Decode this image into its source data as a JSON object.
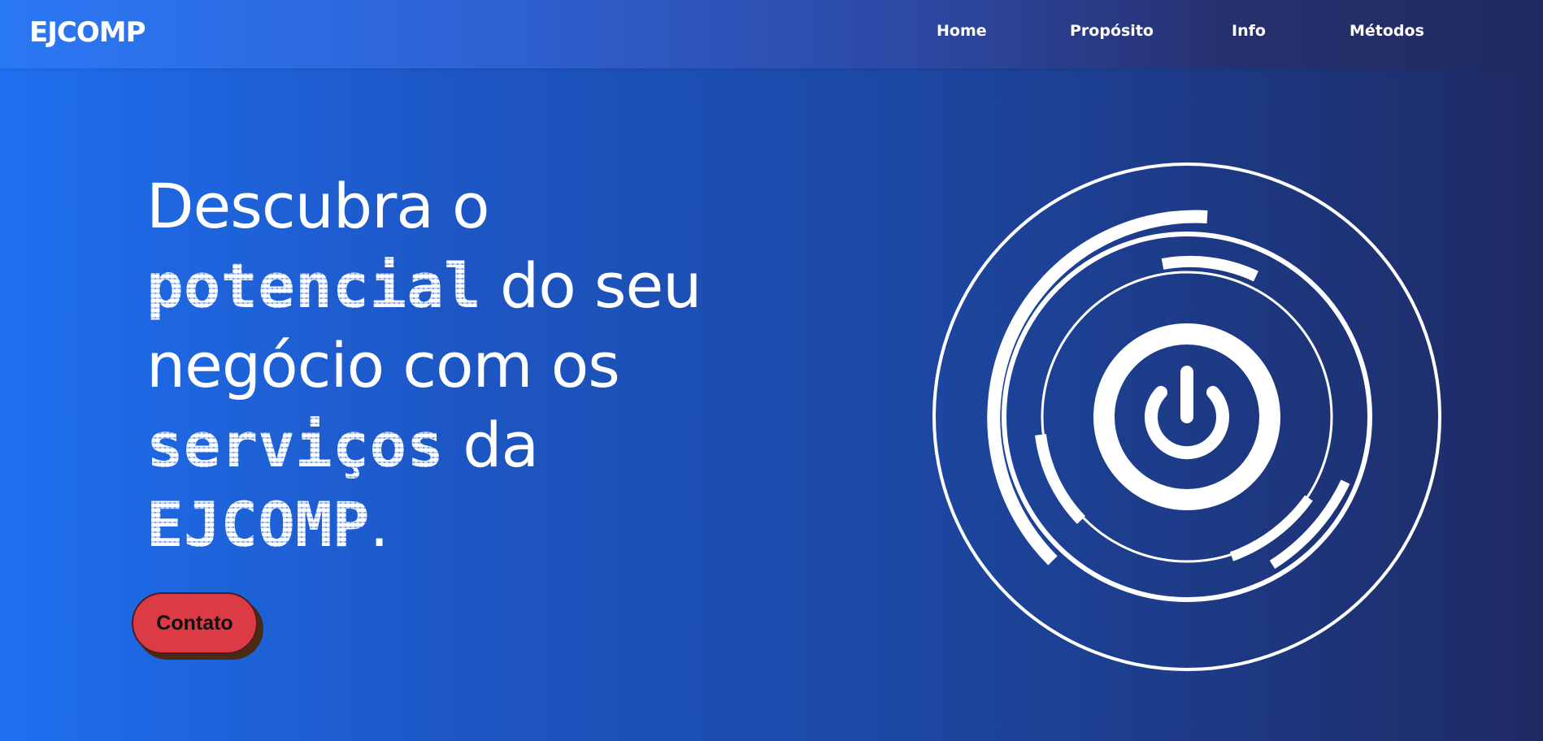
{
  "header": {
    "brand": "EJCOMP",
    "nav": [
      {
        "label": "Home"
      },
      {
        "label": "Propósito"
      },
      {
        "label": "Info"
      },
      {
        "label": "Métodos"
      }
    ]
  },
  "hero": {
    "line1": "Descubra o",
    "highlight1": "potencial",
    "line2_rest": " do seu",
    "line3": "negócio com os",
    "highlight2": "serviços",
    "line4_rest": " da",
    "highlight3": "EJCOMP",
    "period": ".",
    "contact_label": "Contato"
  },
  "graphic": {
    "icon": "power-icon",
    "color": "#ffffff"
  },
  "colors": {
    "accent_button": "#dc3a45",
    "background_start": "#1f6ff0",
    "background_end": "#1f2a63"
  }
}
